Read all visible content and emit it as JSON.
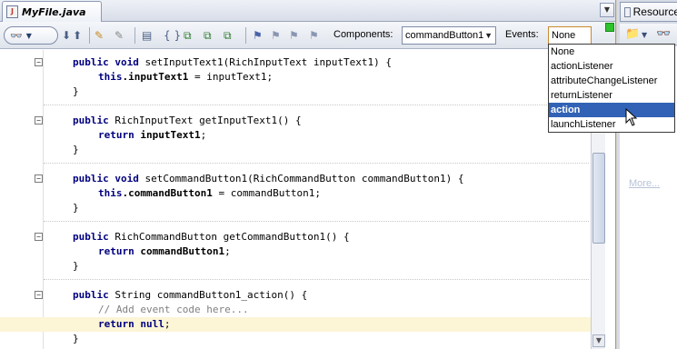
{
  "editor": {
    "tab_label": "MyFile.java",
    "tab_icon": "java-file-icon"
  },
  "toolbar": {
    "search_icon": "binoculars-icon",
    "components_label": "Components:",
    "components_value": "commandButton1",
    "events_label": "Events:",
    "events_value": "None"
  },
  "events_dropdown": {
    "options": [
      "None",
      "actionListener",
      "attributeChangeListener",
      "returnListener",
      "action",
      "launchListener"
    ],
    "selected": "action"
  },
  "code": {
    "lines": [
      {
        "indent": 0,
        "tokens": [
          [
            "kw",
            "public "
          ],
          [
            "kw",
            "void "
          ],
          [
            "",
            "setInputText1(RichInputText inputText1) {"
          ]
        ],
        "fold": true
      },
      {
        "indent": 1,
        "tokens": [
          [
            "kw",
            "this"
          ],
          [
            "fld",
            ".inputText1"
          ],
          [
            "",
            " = inputText1;"
          ]
        ]
      },
      {
        "indent": 0,
        "tokens": [
          [
            "",
            "}"
          ]
        ]
      },
      {
        "indent": 0,
        "tokens": [
          [
            "kw",
            "public "
          ],
          [
            "",
            "RichInputText getInputText1() {"
          ]
        ],
        "fold": true
      },
      {
        "indent": 1,
        "tokens": [
          [
            "kw",
            "return "
          ],
          [
            "fld",
            "inputText1"
          ],
          [
            "",
            ";"
          ]
        ]
      },
      {
        "indent": 0,
        "tokens": [
          [
            "",
            "}"
          ]
        ]
      },
      {
        "indent": 0,
        "tokens": [
          [
            "kw",
            "public "
          ],
          [
            "kw",
            "void "
          ],
          [
            "",
            "setCommandButton1(RichCommandButton commandButton1) {"
          ]
        ],
        "fold": true
      },
      {
        "indent": 1,
        "tokens": [
          [
            "kw",
            "this"
          ],
          [
            "fld",
            ".commandButton1"
          ],
          [
            "",
            " = commandButton1;"
          ]
        ]
      },
      {
        "indent": 0,
        "tokens": [
          [
            "",
            "}"
          ]
        ]
      },
      {
        "indent": 0,
        "tokens": [
          [
            "kw",
            "public "
          ],
          [
            "",
            "RichCommandButton getCommandButton1() {"
          ]
        ],
        "fold": true
      },
      {
        "indent": 1,
        "tokens": [
          [
            "kw",
            "return "
          ],
          [
            "fld",
            "commandButton1"
          ],
          [
            "",
            ";"
          ]
        ]
      },
      {
        "indent": 0,
        "tokens": [
          [
            "",
            "}"
          ]
        ]
      },
      {
        "indent": 0,
        "tokens": [
          [
            "kw",
            "public "
          ],
          [
            "",
            "String commandButton1_action() {"
          ]
        ],
        "fold": true
      },
      {
        "indent": 1,
        "tokens": [
          [
            "cmt",
            "// Add event code here..."
          ]
        ]
      },
      {
        "indent": 1,
        "tokens": [
          [
            "kw",
            "return "
          ],
          [
            "kw",
            "null"
          ],
          [
            "",
            ";"
          ]
        ],
        "highlight": true
      },
      {
        "indent": 0,
        "tokens": [
          [
            "",
            "}"
          ]
        ]
      }
    ]
  },
  "right_panel": {
    "tab_label": "Resource",
    "more_link": "More..."
  }
}
